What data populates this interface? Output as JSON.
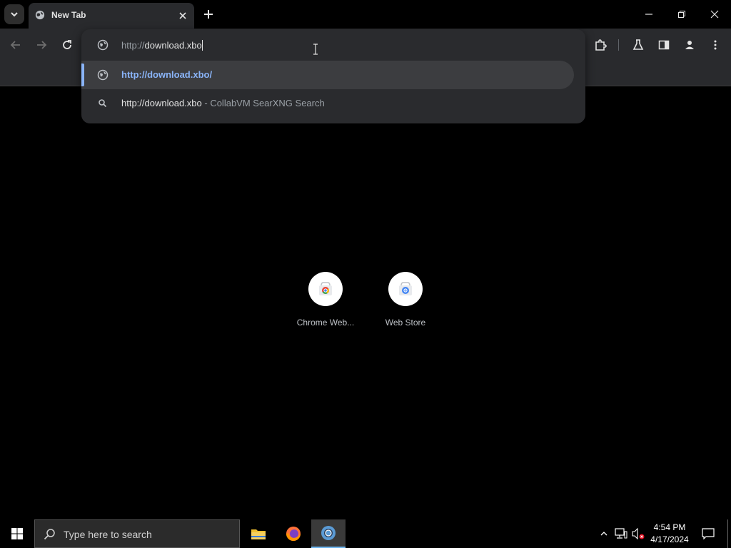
{
  "tab": {
    "title": "New Tab"
  },
  "omnibox": {
    "typed_prefix": "http://",
    "typed_rest": "download.xbo",
    "suggestions": [
      {
        "url": "http://download.xbo/"
      },
      {
        "query": "http://download.xbo",
        "source": "- CollabVM SearXNG Search"
      }
    ]
  },
  "shortcuts": [
    {
      "label": "Chrome Web..."
    },
    {
      "label": "Web Store"
    }
  ],
  "taskbar": {
    "search_placeholder": "Type here to search",
    "time": "4:54 PM",
    "date": "4/17/2024"
  },
  "colors": {
    "accent": "#8ab4f8",
    "toolbar": "#292a2d",
    "background": "#000000"
  }
}
